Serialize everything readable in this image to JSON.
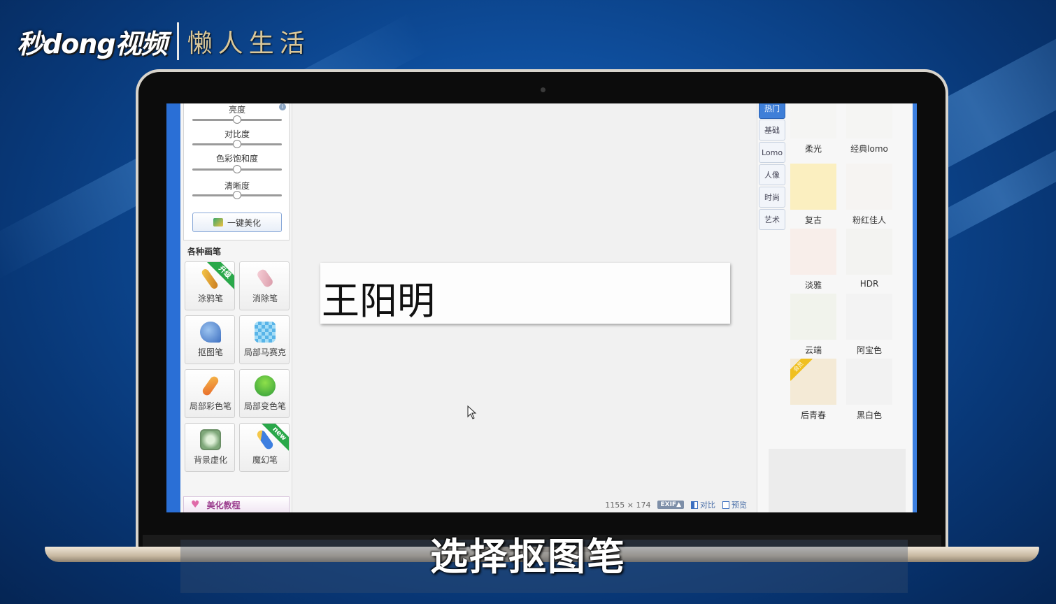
{
  "brand": {
    "logo": "秒dong视频",
    "slogan": "懒人生活"
  },
  "adjust": {
    "sliders": [
      {
        "label": "亮度",
        "value": 0.5
      },
      {
        "label": "对比度",
        "value": 0.5
      },
      {
        "label": "色彩饱和度",
        "value": 0.5
      },
      {
        "label": "清晰度",
        "value": 0.5
      }
    ],
    "onekey_label": "一键美化"
  },
  "brushes": {
    "title": "各种画笔",
    "items": [
      {
        "label": "涂鸦笔",
        "icon": "pencil-icon",
        "badge": "升级"
      },
      {
        "label": "消除笔",
        "icon": "eraser-icon",
        "badge": ""
      },
      {
        "label": "抠图笔",
        "icon": "cutout-pen-icon",
        "badge": ""
      },
      {
        "label": "局部马赛克",
        "icon": "mosaic-icon",
        "badge": ""
      },
      {
        "label": "局部彩色笔",
        "icon": "color-brush-icon",
        "badge": ""
      },
      {
        "label": "局部变色笔",
        "icon": "paint-bucket-icon",
        "badge": ""
      },
      {
        "label": "背景虚化",
        "icon": "blur-bg-icon",
        "badge": ""
      },
      {
        "label": "魔幻笔",
        "icon": "magic-pen-icon",
        "badge": "new"
      }
    ]
  },
  "tutorial_label": "美化教程",
  "canvas": {
    "image_text": "王阳明"
  },
  "status": {
    "dims": "1155 × 174",
    "exif": "EXIF▲",
    "compare": "对比",
    "preview": "预览"
  },
  "tabs": [
    "热门",
    "基础",
    "Lomo",
    "人像",
    "时尚",
    "艺术"
  ],
  "filters": [
    {
      "label": "柔光",
      "color": "#f5f5f3",
      "vip": false
    },
    {
      "label": "经典lomo",
      "color": "#f5f5f3",
      "vip": false
    },
    {
      "label": "复古",
      "color": "#fbefc0",
      "vip": false
    },
    {
      "label": "粉红佳人",
      "color": "#f6f4f2",
      "vip": false
    },
    {
      "label": "淡雅",
      "color": "#f8eeea",
      "vip": false
    },
    {
      "label": "HDR",
      "color": "#f3f3f1",
      "vip": false
    },
    {
      "label": "云端",
      "color": "#f1f3ec",
      "vip": false
    },
    {
      "label": "阿宝色",
      "color": "#f3f3f3",
      "vip": false
    },
    {
      "label": "后青春",
      "color": "#f4ead6",
      "vip": true,
      "vip_text": "会员"
    },
    {
      "label": "黑白色",
      "color": "#f2f2f2",
      "vip": false
    }
  ],
  "subtitle": "选择抠图笔"
}
